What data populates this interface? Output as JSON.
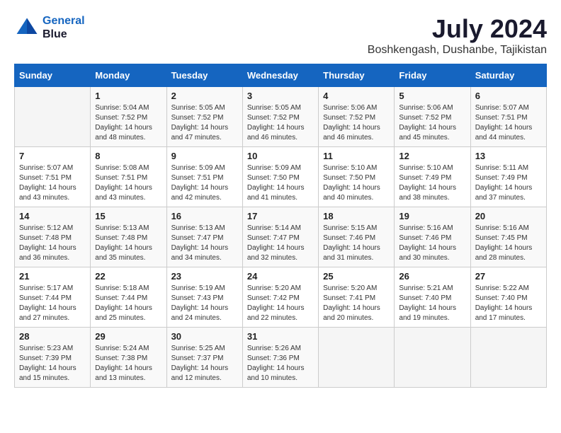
{
  "header": {
    "logo_line1": "General",
    "logo_line2": "Blue",
    "month_year": "July 2024",
    "location": "Boshkengash, Dushanbe, Tajikistan"
  },
  "weekdays": [
    "Sunday",
    "Monday",
    "Tuesday",
    "Wednesday",
    "Thursday",
    "Friday",
    "Saturday"
  ],
  "weeks": [
    [
      {
        "day": "",
        "sunrise": "",
        "sunset": "",
        "daylight": ""
      },
      {
        "day": "1",
        "sunrise": "Sunrise: 5:04 AM",
        "sunset": "Sunset: 7:52 PM",
        "daylight": "Daylight: 14 hours and 48 minutes."
      },
      {
        "day": "2",
        "sunrise": "Sunrise: 5:05 AM",
        "sunset": "Sunset: 7:52 PM",
        "daylight": "Daylight: 14 hours and 47 minutes."
      },
      {
        "day": "3",
        "sunrise": "Sunrise: 5:05 AM",
        "sunset": "Sunset: 7:52 PM",
        "daylight": "Daylight: 14 hours and 46 minutes."
      },
      {
        "day": "4",
        "sunrise": "Sunrise: 5:06 AM",
        "sunset": "Sunset: 7:52 PM",
        "daylight": "Daylight: 14 hours and 46 minutes."
      },
      {
        "day": "5",
        "sunrise": "Sunrise: 5:06 AM",
        "sunset": "Sunset: 7:52 PM",
        "daylight": "Daylight: 14 hours and 45 minutes."
      },
      {
        "day": "6",
        "sunrise": "Sunrise: 5:07 AM",
        "sunset": "Sunset: 7:51 PM",
        "daylight": "Daylight: 14 hours and 44 minutes."
      }
    ],
    [
      {
        "day": "7",
        "sunrise": "Sunrise: 5:07 AM",
        "sunset": "Sunset: 7:51 PM",
        "daylight": "Daylight: 14 hours and 43 minutes."
      },
      {
        "day": "8",
        "sunrise": "Sunrise: 5:08 AM",
        "sunset": "Sunset: 7:51 PM",
        "daylight": "Daylight: 14 hours and 43 minutes."
      },
      {
        "day": "9",
        "sunrise": "Sunrise: 5:09 AM",
        "sunset": "Sunset: 7:51 PM",
        "daylight": "Daylight: 14 hours and 42 minutes."
      },
      {
        "day": "10",
        "sunrise": "Sunrise: 5:09 AM",
        "sunset": "Sunset: 7:50 PM",
        "daylight": "Daylight: 14 hours and 41 minutes."
      },
      {
        "day": "11",
        "sunrise": "Sunrise: 5:10 AM",
        "sunset": "Sunset: 7:50 PM",
        "daylight": "Daylight: 14 hours and 40 minutes."
      },
      {
        "day": "12",
        "sunrise": "Sunrise: 5:10 AM",
        "sunset": "Sunset: 7:49 PM",
        "daylight": "Daylight: 14 hours and 38 minutes."
      },
      {
        "day": "13",
        "sunrise": "Sunrise: 5:11 AM",
        "sunset": "Sunset: 7:49 PM",
        "daylight": "Daylight: 14 hours and 37 minutes."
      }
    ],
    [
      {
        "day": "14",
        "sunrise": "Sunrise: 5:12 AM",
        "sunset": "Sunset: 7:48 PM",
        "daylight": "Daylight: 14 hours and 36 minutes."
      },
      {
        "day": "15",
        "sunrise": "Sunrise: 5:13 AM",
        "sunset": "Sunset: 7:48 PM",
        "daylight": "Daylight: 14 hours and 35 minutes."
      },
      {
        "day": "16",
        "sunrise": "Sunrise: 5:13 AM",
        "sunset": "Sunset: 7:47 PM",
        "daylight": "Daylight: 14 hours and 34 minutes."
      },
      {
        "day": "17",
        "sunrise": "Sunrise: 5:14 AM",
        "sunset": "Sunset: 7:47 PM",
        "daylight": "Daylight: 14 hours and 32 minutes."
      },
      {
        "day": "18",
        "sunrise": "Sunrise: 5:15 AM",
        "sunset": "Sunset: 7:46 PM",
        "daylight": "Daylight: 14 hours and 31 minutes."
      },
      {
        "day": "19",
        "sunrise": "Sunrise: 5:16 AM",
        "sunset": "Sunset: 7:46 PM",
        "daylight": "Daylight: 14 hours and 30 minutes."
      },
      {
        "day": "20",
        "sunrise": "Sunrise: 5:16 AM",
        "sunset": "Sunset: 7:45 PM",
        "daylight": "Daylight: 14 hours and 28 minutes."
      }
    ],
    [
      {
        "day": "21",
        "sunrise": "Sunrise: 5:17 AM",
        "sunset": "Sunset: 7:44 PM",
        "daylight": "Daylight: 14 hours and 27 minutes."
      },
      {
        "day": "22",
        "sunrise": "Sunrise: 5:18 AM",
        "sunset": "Sunset: 7:44 PM",
        "daylight": "Daylight: 14 hours and 25 minutes."
      },
      {
        "day": "23",
        "sunrise": "Sunrise: 5:19 AM",
        "sunset": "Sunset: 7:43 PM",
        "daylight": "Daylight: 14 hours and 24 minutes."
      },
      {
        "day": "24",
        "sunrise": "Sunrise: 5:20 AM",
        "sunset": "Sunset: 7:42 PM",
        "daylight": "Daylight: 14 hours and 22 minutes."
      },
      {
        "day": "25",
        "sunrise": "Sunrise: 5:20 AM",
        "sunset": "Sunset: 7:41 PM",
        "daylight": "Daylight: 14 hours and 20 minutes."
      },
      {
        "day": "26",
        "sunrise": "Sunrise: 5:21 AM",
        "sunset": "Sunset: 7:40 PM",
        "daylight": "Daylight: 14 hours and 19 minutes."
      },
      {
        "day": "27",
        "sunrise": "Sunrise: 5:22 AM",
        "sunset": "Sunset: 7:40 PM",
        "daylight": "Daylight: 14 hours and 17 minutes."
      }
    ],
    [
      {
        "day": "28",
        "sunrise": "Sunrise: 5:23 AM",
        "sunset": "Sunset: 7:39 PM",
        "daylight": "Daylight: 14 hours and 15 minutes."
      },
      {
        "day": "29",
        "sunrise": "Sunrise: 5:24 AM",
        "sunset": "Sunset: 7:38 PM",
        "daylight": "Daylight: 14 hours and 13 minutes."
      },
      {
        "day": "30",
        "sunrise": "Sunrise: 5:25 AM",
        "sunset": "Sunset: 7:37 PM",
        "daylight": "Daylight: 14 hours and 12 minutes."
      },
      {
        "day": "31",
        "sunrise": "Sunrise: 5:26 AM",
        "sunset": "Sunset: 7:36 PM",
        "daylight": "Daylight: 14 hours and 10 minutes."
      },
      {
        "day": "",
        "sunrise": "",
        "sunset": "",
        "daylight": ""
      },
      {
        "day": "",
        "sunrise": "",
        "sunset": "",
        "daylight": ""
      },
      {
        "day": "",
        "sunrise": "",
        "sunset": "",
        "daylight": ""
      }
    ]
  ]
}
